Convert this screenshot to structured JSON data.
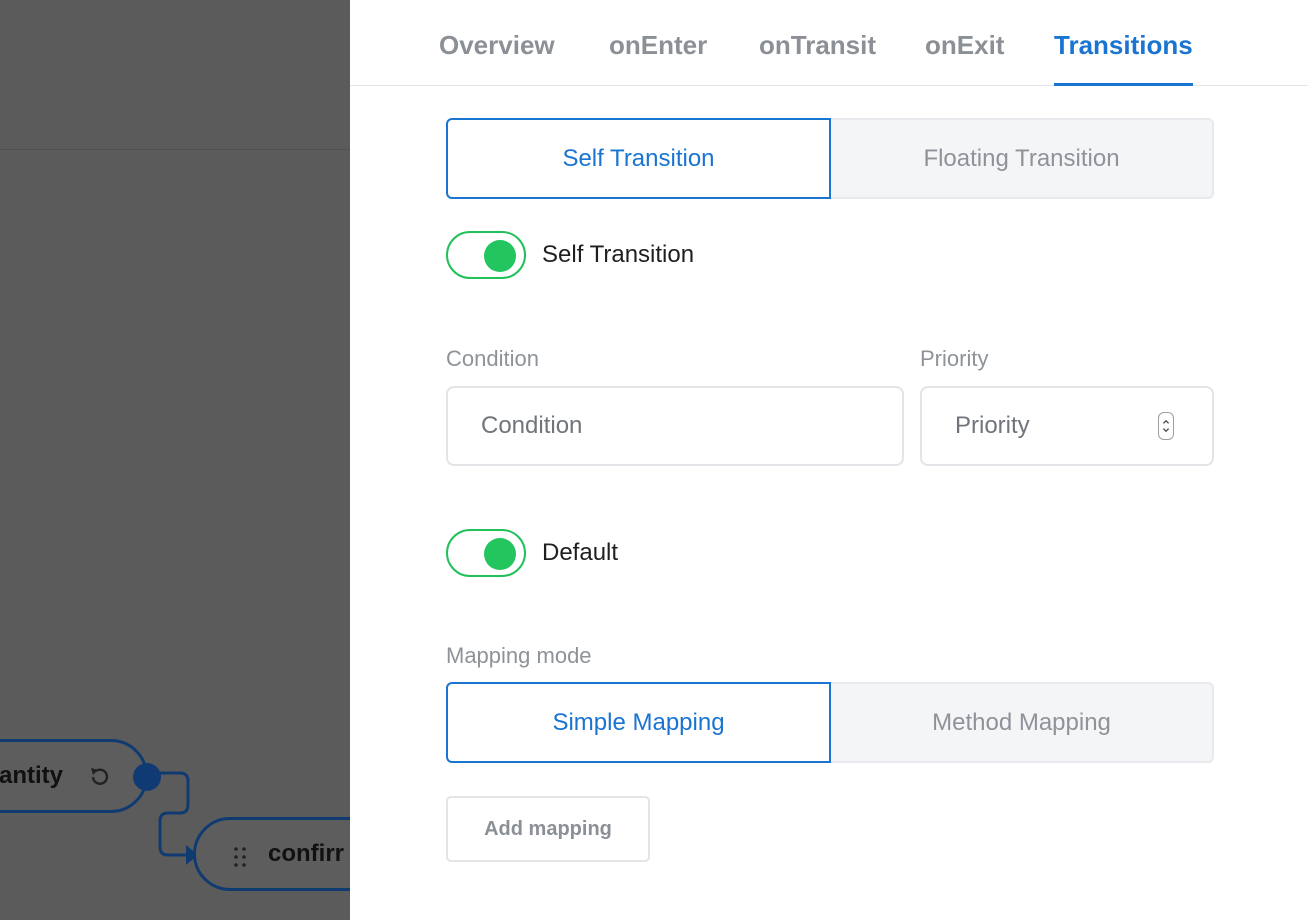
{
  "canvas": {
    "node_quantity_label": "antity",
    "node_confirm_label": "confirr"
  },
  "tabs": [
    {
      "label": "Overview"
    },
    {
      "label": "onEnter"
    },
    {
      "label": "onTransit"
    },
    {
      "label": "onExit"
    },
    {
      "label": "Transitions",
      "active": true
    }
  ],
  "transition_type": {
    "options": [
      "Self Transition",
      "Floating Transition"
    ],
    "selected": "Self Transition"
  },
  "self_transition": {
    "label": "Self Transition",
    "enabled": true
  },
  "condition": {
    "label": "Condition",
    "placeholder": "Condition"
  },
  "priority": {
    "label": "Priority",
    "placeholder": "Priority"
  },
  "default": {
    "label": "Default",
    "enabled": true
  },
  "mapping_mode": {
    "label": "Mapping mode",
    "options": [
      "Simple Mapping",
      "Method Mapping"
    ],
    "selected": "Simple Mapping"
  },
  "add_mapping_label": "Add mapping",
  "colors": {
    "accent": "#1a74d1",
    "toggle_on": "#22c55e",
    "node_border": "#103b70",
    "overlay": "#5b5b5b"
  }
}
